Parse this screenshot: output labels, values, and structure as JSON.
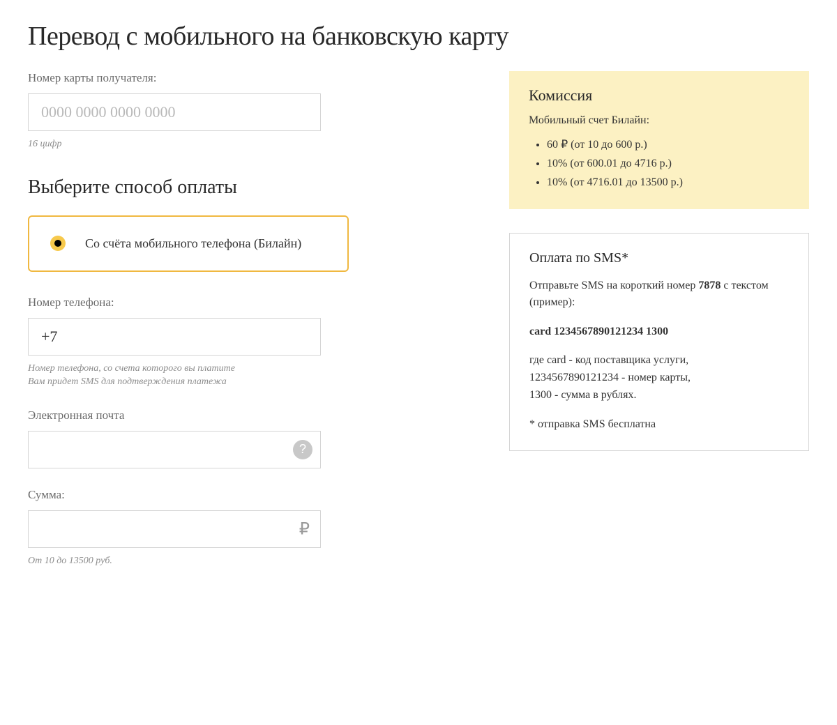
{
  "page_title": "Перевод с мобильного на банковскую карту",
  "card": {
    "label": "Номер карты получателя:",
    "placeholder": "0000 0000 0000 0000",
    "hint": "16 цифр"
  },
  "payment_method": {
    "heading": "Выберите способ оплаты",
    "option_label": "Со счёта мобильного телефона (Билайн)"
  },
  "phone": {
    "label": "Номер телефона:",
    "value": "+7",
    "hint1": "Номер телефона, со счета которого вы платите",
    "hint2": "Вам придет SMS для подтверждения платежа"
  },
  "email": {
    "label": "Электронная почта",
    "help": "?"
  },
  "amount": {
    "label": "Сумма:",
    "currency": "₽",
    "hint": "От 10 до 13500 руб."
  },
  "commission": {
    "title": "Комиссия",
    "subtitle": "Мобильный счет Билайн:",
    "items": [
      "60 ₽ (от 10 до 600 р.)",
      "10% (от 600.01 до 4716 р.)",
      "10% (от 4716.01 до 13500 р.)"
    ]
  },
  "sms": {
    "title": "Оплата по SMS*",
    "intro_pre": "Отправьте SMS на короткий номер ",
    "intro_num": "7878",
    "intro_post": " с текстом (пример):",
    "example": "card 1234567890121234 1300",
    "explain1": "где card - код поставщика услуги,",
    "explain2": "1234567890121234 - номер карты,",
    "explain3": "1300 - сумма в рублях.",
    "note": "* отправка SMS бесплатна"
  }
}
